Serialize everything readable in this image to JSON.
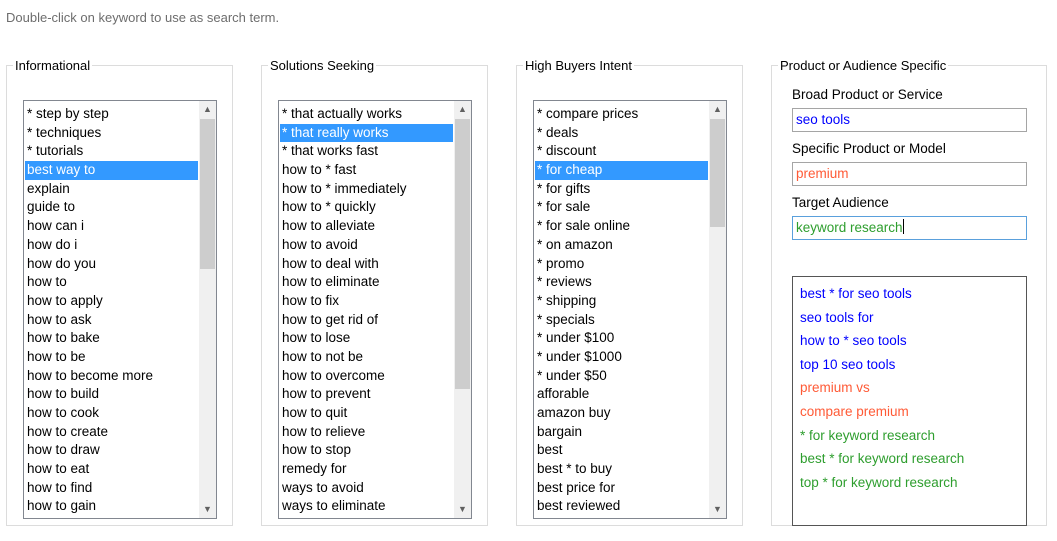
{
  "instruction": "Double-click on keyword to use as search term.",
  "colors": {
    "selection": "#3399ff",
    "blue": "#0000ff",
    "orange": "#ff5a36",
    "green": "#2e9e2e"
  },
  "groups": [
    {
      "legend": "Informational",
      "items": [
        "* step by step",
        "* techniques",
        "* tutorials",
        "best way to",
        "explain",
        "guide to",
        "how can i",
        "how do i",
        "how do you",
        "how to",
        "how to apply",
        "how to ask",
        "how to bake",
        "how to be",
        "how to become more",
        "how to build",
        "how to cook",
        "how to create",
        "how to draw",
        "how to eat",
        "how to find",
        "how to gain"
      ],
      "selected_index": 3,
      "scroll_fraction": 0.0
    },
    {
      "legend": "Solutions Seeking",
      "items": [
        "* that actually works",
        "* that really works",
        "* that works fast",
        "how to * fast",
        "how to * immediately",
        "how to * quickly",
        "how to alleviate",
        "how to avoid",
        "how to deal with",
        "how to eliminate",
        "how to fix",
        "how to get rid of",
        "how to lose",
        "how to not be",
        "how to overcome",
        "how to prevent",
        "how to quit",
        "how to relieve",
        "how to stop",
        "remedy for",
        "ways to avoid",
        "ways to eliminate"
      ],
      "selected_index": 1,
      "scroll_fraction": 0.0
    },
    {
      "legend": "High Buyers Intent",
      "items": [
        "* compare prices",
        "* deals",
        "* discount",
        "* for cheap",
        "* for gifts",
        "* for sale",
        "* for sale online",
        "* on amazon",
        "* promo",
        "* reviews",
        "* shipping",
        "* specials",
        "* under $100",
        "* under $1000",
        "* under $50",
        "afforable",
        "amazon buy",
        "bargain",
        "best",
        "best * to buy",
        "best price for",
        "best reviewed"
      ],
      "selected_index": 3,
      "scroll_fraction": 0.0
    }
  ],
  "product": {
    "legend": "Product or Audience Specific",
    "broad_label": "Broad Product or Service",
    "broad_value": "seo tools",
    "specific_label": "Specific Product or Model",
    "specific_value": "premium",
    "audience_label": "Target Audience",
    "audience_value": "keyword research",
    "results": [
      {
        "text": "best * for seo tools",
        "color": "#0000ff"
      },
      {
        "text": "seo tools for",
        "color": "#0000ff"
      },
      {
        "text": "how to * seo tools",
        "color": "#0000ff"
      },
      {
        "text": "top 10 seo tools",
        "color": "#0000ff"
      },
      {
        "text": "premium vs",
        "color": "#ff5a36"
      },
      {
        "text": "compare premium",
        "color": "#ff5a36"
      },
      {
        "text": "* for keyword research",
        "color": "#2e9e2e"
      },
      {
        "text": "best * for keyword research",
        "color": "#2e9e2e"
      },
      {
        "text": "top * for keyword research",
        "color": "#2e9e2e"
      }
    ]
  }
}
